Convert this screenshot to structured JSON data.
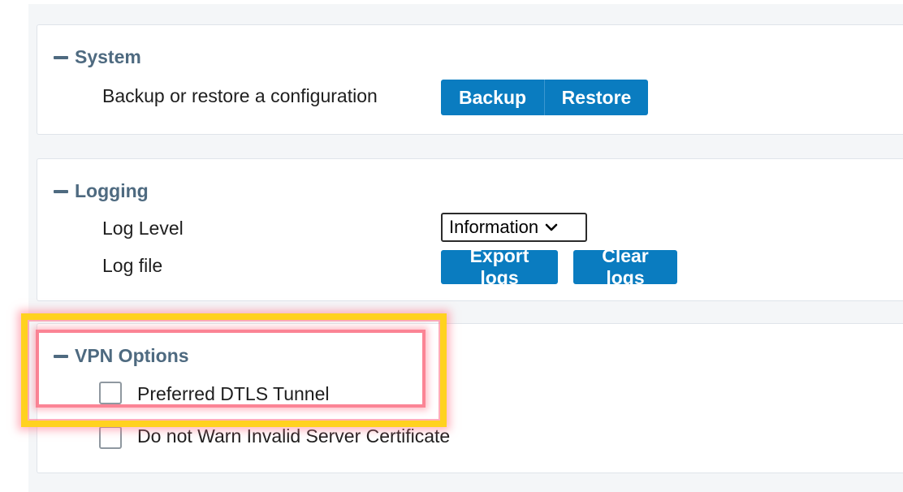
{
  "system": {
    "title": "System",
    "backup_label": "Backup or restore a configuration",
    "backup_button": "Backup",
    "restore_button": "Restore"
  },
  "logging": {
    "title": "Logging",
    "log_level_label": "Log Level",
    "log_level_value": "Information",
    "log_file_label": "Log file",
    "export_button": "Export logs",
    "clear_button": "Clear logs"
  },
  "vpn": {
    "title": "VPN Options",
    "option_dtls": "Preferred DTLS Tunnel",
    "option_cert": "Do not Warn Invalid Server Certificate"
  },
  "colors": {
    "accent": "#0a7cc0",
    "section_title": "#4e6a80",
    "highlight_border": "#ffd21f",
    "highlight_glow": "#ff7890"
  }
}
